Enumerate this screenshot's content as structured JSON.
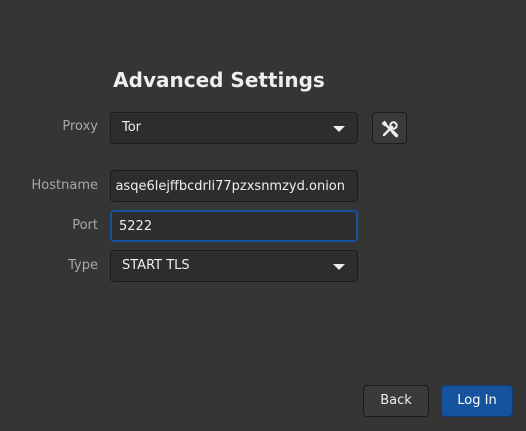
{
  "dialog": {
    "title": "Advanced Settings"
  },
  "form": {
    "proxy": {
      "label": "Proxy",
      "selected": "Tor",
      "settings_icon": "tools-icon"
    },
    "hostname": {
      "label": "Hostname",
      "value": "asqe6lejffbcdrli77pzxsnmzyd.onion"
    },
    "port": {
      "label": "Port",
      "value": "5222"
    },
    "type": {
      "label": "Type",
      "selected": "START TLS"
    }
  },
  "actions": {
    "back_label": "Back",
    "login_label": "Log In"
  },
  "colors": {
    "background": "#353535",
    "accent": "#15539e",
    "text": "#eeeeec",
    "label": "#a8a8a6"
  }
}
